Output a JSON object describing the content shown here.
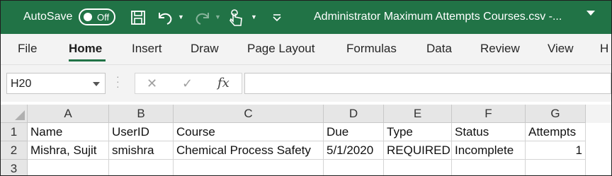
{
  "titlebar": {
    "autosave_label": "AutoSave",
    "autosave_state": "Off",
    "filename": "Administrator Maximum Attempts Courses.csv  -...",
    "accent_color": "#217346",
    "icons": [
      "save-icon",
      "undo-icon",
      "redo-icon",
      "touch-mode-icon",
      "customize-qat-icon",
      "ribbon-display-dropdown-icon"
    ]
  },
  "ribbon": {
    "tabs": [
      {
        "label": "File"
      },
      {
        "label": "Home"
      },
      {
        "label": "Insert"
      },
      {
        "label": "Draw"
      },
      {
        "label": "Page Layout"
      },
      {
        "label": "Formulas"
      },
      {
        "label": "Data"
      },
      {
        "label": "Review"
      },
      {
        "label": "View"
      },
      {
        "label": "H"
      }
    ],
    "active_tab": "Home"
  },
  "formula_bar": {
    "name_box": "H20",
    "cancel_glyph": "✕",
    "enter_glyph": "✓",
    "fx_label": "fx",
    "formula": ""
  },
  "sheet": {
    "columns": [
      "A",
      "B",
      "C",
      "D",
      "E",
      "F",
      "G"
    ],
    "rows": [
      {
        "num": "1",
        "cells": [
          "Name",
          "UserID",
          "Course",
          "Due",
          "Type",
          "Status",
          "Attempts"
        ]
      },
      {
        "num": "2",
        "cells": [
          "Mishra, Sujit",
          "smishra",
          "Chemical Process Safety",
          "5/1/2020",
          "REQUIRED",
          "Incomplete",
          "1"
        ]
      },
      {
        "num": "3",
        "cells": [
          "",
          "",
          "",
          "",
          "",
          "",
          ""
        ]
      }
    ]
  }
}
